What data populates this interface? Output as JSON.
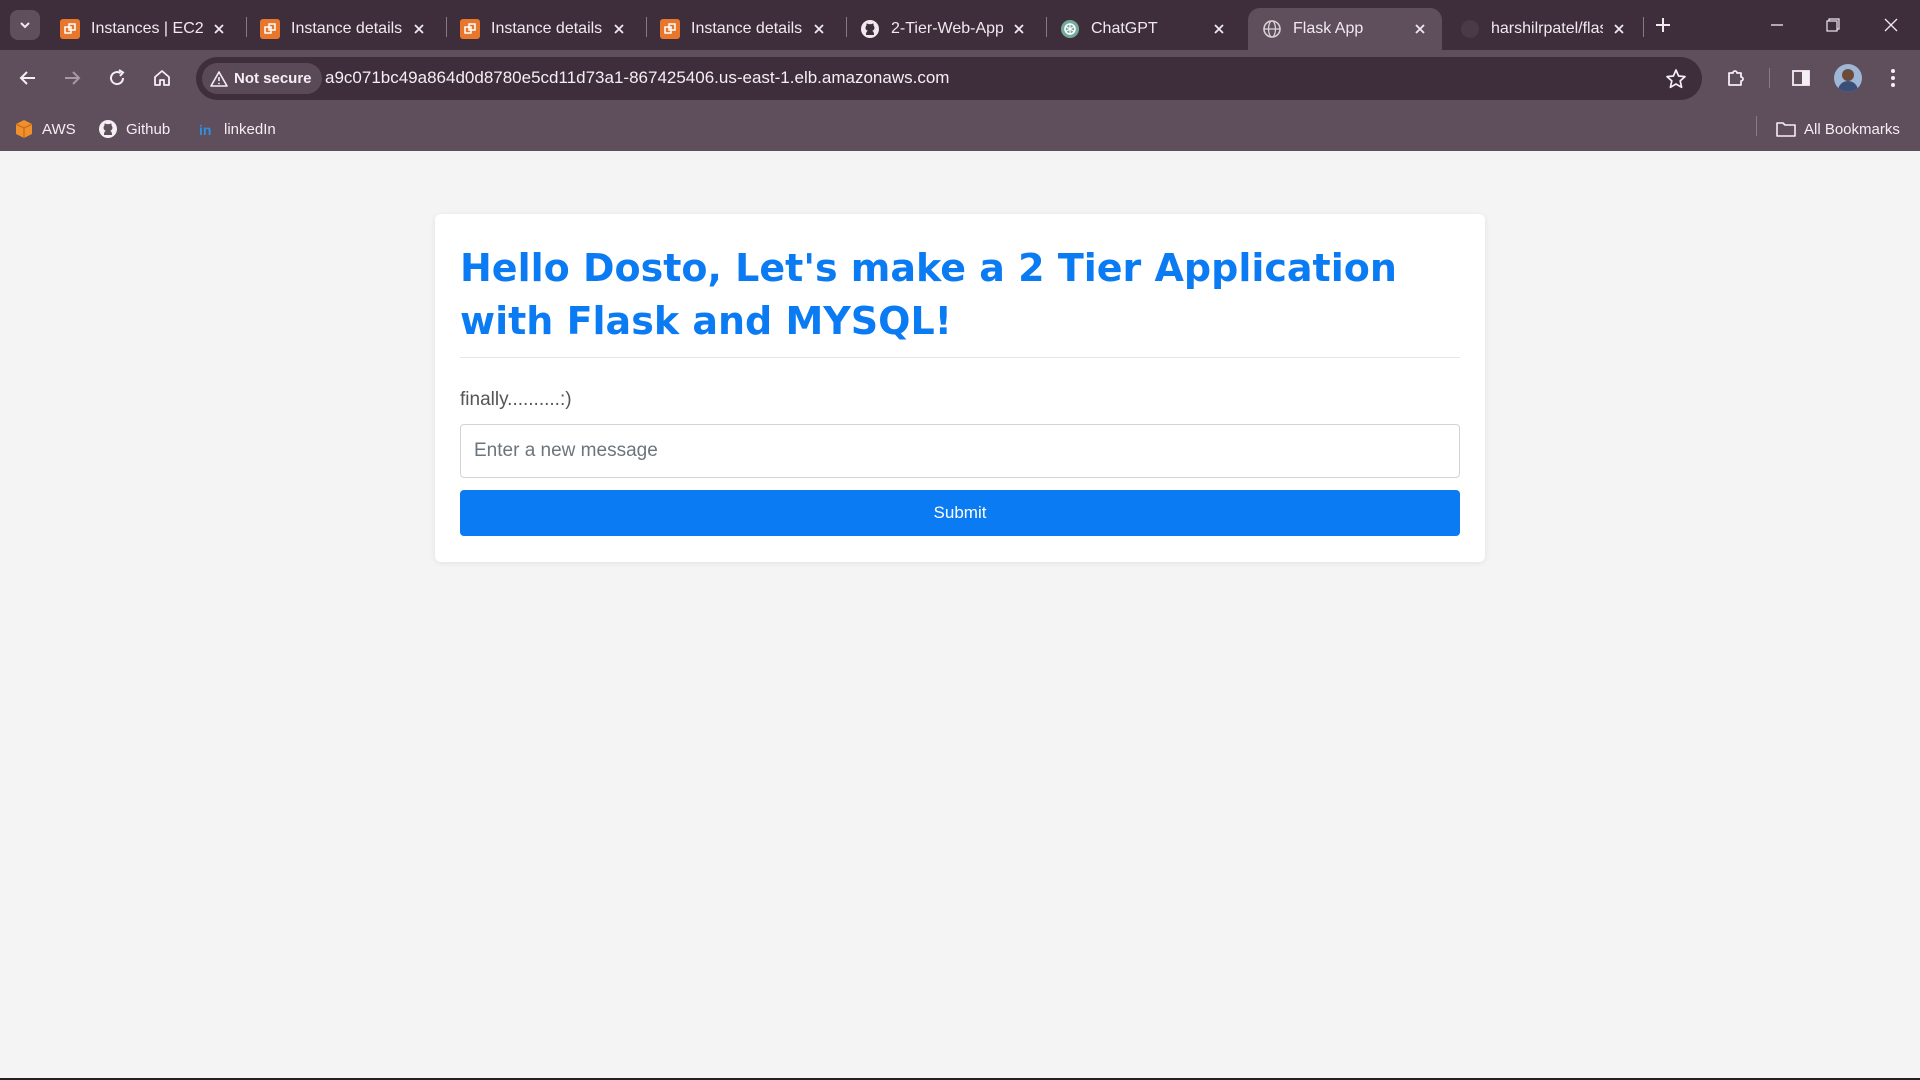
{
  "browser": {
    "tabs": [
      {
        "title": "Instances | EC2 |",
        "favicon": "aws-icon"
      },
      {
        "title": "Instance details |",
        "favicon": "aws-icon"
      },
      {
        "title": "Instance details |",
        "favicon": "aws-icon"
      },
      {
        "title": "Instance details |",
        "favicon": "aws-icon"
      },
      {
        "title": "2-Tier-Web-App",
        "favicon": "github-icon"
      },
      {
        "title": "ChatGPT",
        "favicon": "chatgpt-icon"
      },
      {
        "title": "Flask App",
        "favicon": "globe-icon",
        "active": true
      },
      {
        "title": "harshilrpatel/flas",
        "favicon": "github-icon"
      }
    ],
    "security_label": "Not secure",
    "url": "a9c071bc49a864d0d8780e5cd11d73a1-867425406.us-east-1.elb.amazonaws.com",
    "bookmarks": [
      {
        "label": "AWS",
        "icon": "aws-cube-icon"
      },
      {
        "label": "Github",
        "icon": "github-icon"
      },
      {
        "label": "linkedIn",
        "icon": "linkedin-icon"
      }
    ],
    "all_bookmarks_label": "All Bookmarks",
    "colors": {
      "frame": "#3e2e3b",
      "toolbar": "#5f4e5c"
    }
  },
  "page": {
    "heading": "Hello Dosto, Let's make a 2 Tier Application with Flask and MYSQL!",
    "messages": [
      "finally..........:)"
    ],
    "input_placeholder": "Enter a new message",
    "submit_label": "Submit",
    "accent_color": "#0a7bf3"
  }
}
